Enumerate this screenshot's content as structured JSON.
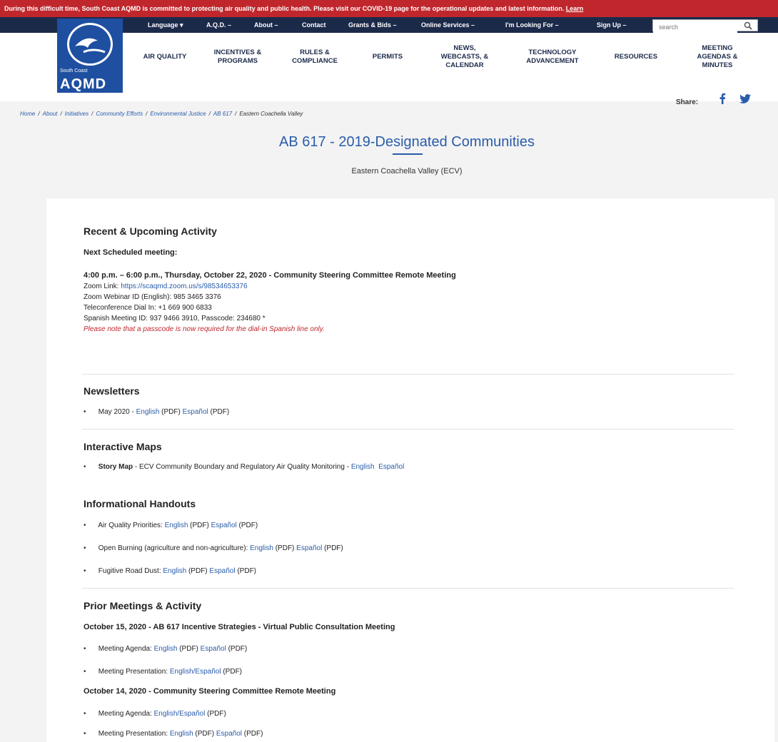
{
  "alert": {
    "text": "During this difficult time, South Coast AQMD is committed to protecting air quality and public health. Please visit our COVID-19 page for the operational updates and latest information.",
    "link": "Learn"
  },
  "utility_nav": [
    {
      "label": "Language ▾"
    },
    {
      "label": "A.Q.D. –"
    },
    {
      "label": "About –"
    },
    {
      "label": "Contact"
    },
    {
      "label": "Grants & Bids –"
    },
    {
      "label": "Online Services –"
    },
    {
      "label": "I'm Looking For –"
    },
    {
      "label": "Sign Up –"
    }
  ],
  "search": {
    "placeholder": "search"
  },
  "logo": {
    "line1": "South Coast",
    "line2": "AQMD"
  },
  "main_nav": [
    {
      "line1": "AIR QUALITY",
      "line2": "",
      "line3": ""
    },
    {
      "line1": "INCENTIVES &",
      "line2": "PROGRAMS",
      "line3": ""
    },
    {
      "line1": "RULES &",
      "line2": "COMPLIANCE",
      "line3": ""
    },
    {
      "line1": "PERMITS",
      "line2": "",
      "line3": ""
    },
    {
      "line1": "NEWS,",
      "line2": "WEBCASTS, &",
      "line3": "CALENDAR"
    },
    {
      "line1": "TECHNOLOGY",
      "line2": "ADVANCEMENT",
      "line3": ""
    },
    {
      "line1": "RESOURCES",
      "line2": "",
      "line3": ""
    },
    {
      "line1": "MEETING",
      "line2": "AGENDAS &",
      "line3": "MINUTES"
    }
  ],
  "share": {
    "label": "Share:"
  },
  "breadcrumb": [
    "Home",
    "About",
    "Initiatives",
    "Community Efforts",
    "Environmental Justice",
    "AB 617",
    "Eastern Coachella Valley"
  ],
  "page": {
    "title": "AB 617 - 2019-Designated Communities",
    "subtitle": "Eastern Coachella Valley (ECV)"
  },
  "recent": {
    "heading": "Recent & Upcoming Activity",
    "next_label": "Next Scheduled meeting:",
    "meeting_title": "4:00 p.m. – 6:00 p.m., Thursday, October 22, 2020 - Community Steering Committee Remote Meeting",
    "zoom_label": "Zoom Link:",
    "zoom_link": "https://scaqmd.zoom.us/s/98534653376",
    "webinar": "Zoom Webinar ID (English): 985 3465 3376",
    "teleconf": "Teleconference Dial In: +1 669 900 6833",
    "spanish": "Spanish Meeting ID: 937 9466 3910, Passcode: 234680 *",
    "note": "Please note that a passcode is now required for the dial-in Spanish line only."
  },
  "newsletters": {
    "heading": "Newsletters",
    "items": [
      {
        "date": "May 2020",
        "sep": " - ",
        "english": "English",
        "pdf1": " (PDF) ",
        "espanol": "Español",
        "pdf2": " (PDF)"
      }
    ]
  },
  "maps": {
    "heading": "Interactive Maps",
    "items": [
      {
        "name": "Story Map",
        "desc": " - ECV Community Boundary and Regulatory Air Quality Monitoring - ",
        "english": "English",
        "espanol": "Español"
      }
    ]
  },
  "handouts": {
    "heading": "Informational Handouts",
    "items": [
      {
        "label": "Air Quality Priorities: ",
        "english": "English",
        "pdf1": " (PDF) ",
        "espanol": "Español",
        "pdf2": " (PDF)"
      },
      {
        "label": "Open Burning (agriculture and non-agriculture): ",
        "english": "English",
        "pdf1": " (PDF) ",
        "espanol": "Español",
        "pdf2": " (PDF)"
      },
      {
        "label": "Fugitive Road Dust: ",
        "english": "English",
        "pdf1": " (PDF) ",
        "espanol": "Español",
        "pdf2": " (PDF)"
      }
    ]
  },
  "prior": {
    "heading": "Prior Meetings & Activity",
    "m1_title": "October 15, 2020 - AB 617 Incentive Strategies - Virtual Public Consultation Meeting",
    "m1_items": [
      {
        "label": "Meeting Agenda: ",
        "link1": "English",
        "pdf1": " (PDF) ",
        "link2": "Español",
        "pdf2": " (PDF)"
      },
      {
        "label": "Meeting Presentation: ",
        "link1": "English/Español",
        "pdf1": " (PDF)",
        "link2": "",
        "pdf2": ""
      }
    ],
    "m2_title": "October 14, 2020 - Community Steering Committee Remote Meeting",
    "m2_items": [
      {
        "label": "Meeting Agenda: ",
        "link1": "English/Español",
        "pdf1": " (PDF)",
        "link2": "",
        "pdf2": ""
      },
      {
        "label": "Meeting Presentation: ",
        "link1": "English",
        "pdf1": " (PDF) ",
        "link2": "Español",
        "pdf2": " (PDF)"
      }
    ]
  },
  "colors": {
    "alert": "#c0272d",
    "utility_bar": "#1c2a4a",
    "brand": "#1e4fa0",
    "link": "#2a5caa"
  }
}
